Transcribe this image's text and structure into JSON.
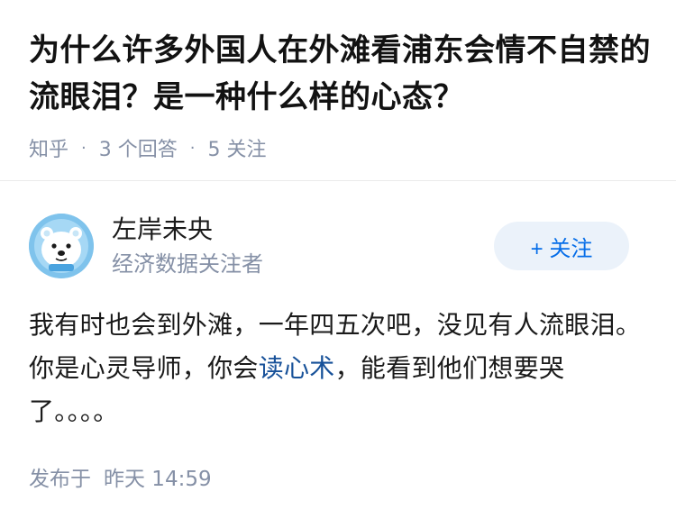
{
  "question": {
    "title": "为什么许多外国人在外滩看浦东会情不自禁的流眼泪？是一种什么样的心态？",
    "source": "知乎",
    "answer_count": "3 个回答",
    "follower_count": "5 关注"
  },
  "answer": {
    "author_name": "左岸未央",
    "author_bio": "经济数据关注者",
    "follow_button": "+ 关注",
    "content_before_link": "我有时也会到外滩，一年四五次吧，没见有人流眼泪。 你是心灵导师，你会",
    "content_link": "读心术",
    "content_after_link": "，能看到他们想要哭了。。。。",
    "publish_label": "发布于",
    "publish_time": "昨天 14:59"
  },
  "icons": {
    "avatar": "polar-bear-avatar-icon"
  },
  "colors": {
    "accent": "#056de8",
    "link": "#175199",
    "muted": "#8590a6",
    "follow_bg": "#ebf2fa"
  }
}
